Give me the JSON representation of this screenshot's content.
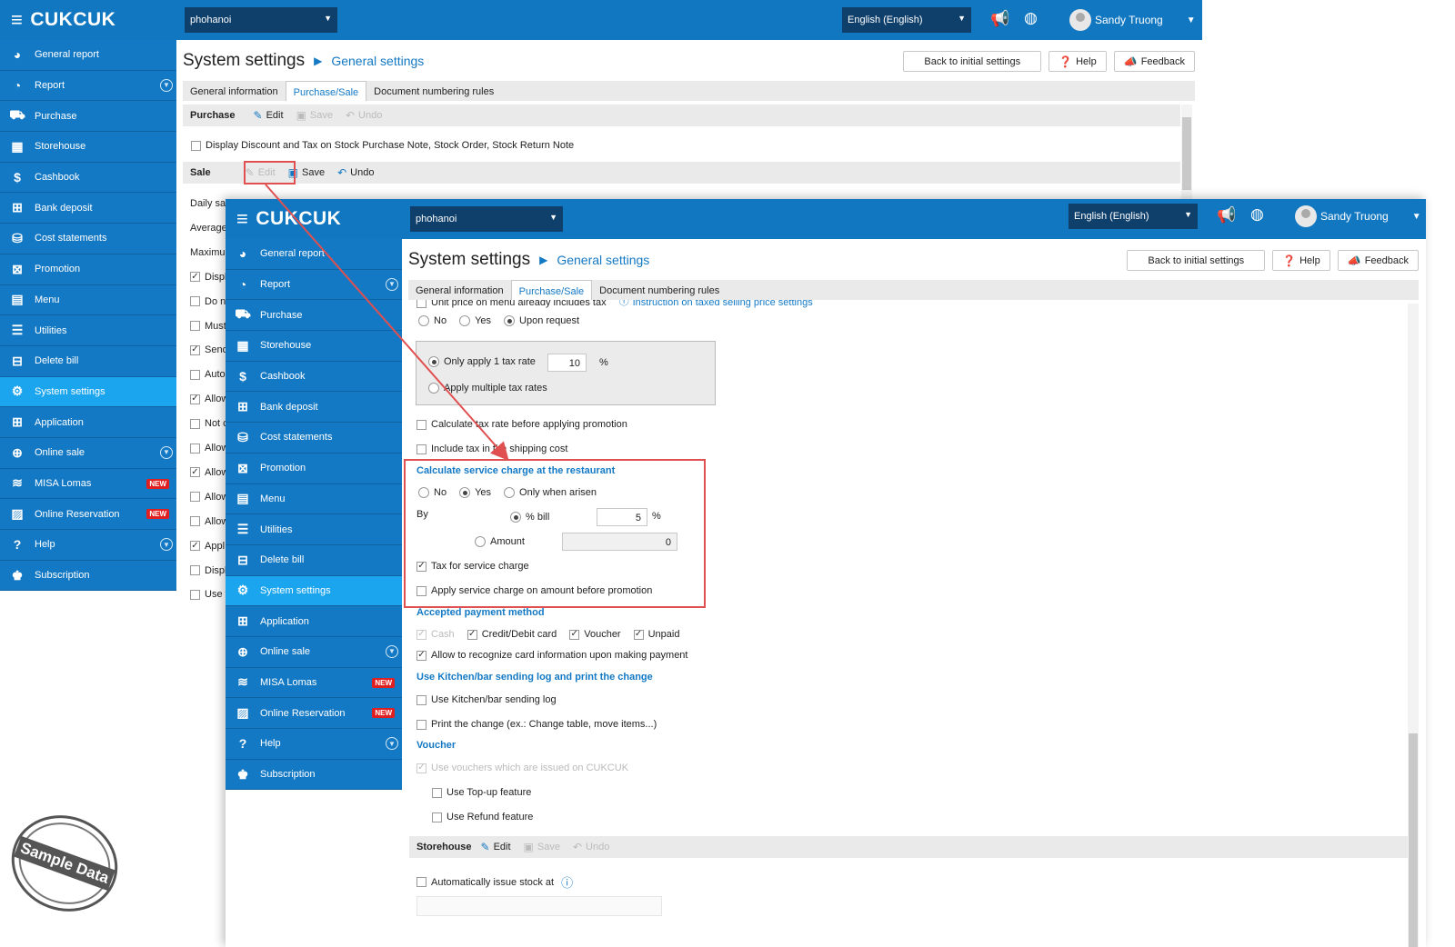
{
  "app": {
    "logo": "CUKCUK",
    "branch": "phohanoi",
    "language": "English (English)",
    "user": "Sandy Truong"
  },
  "sidebar": [
    {
      "label": "General report",
      "icon": "dashboard-icon",
      "glyph": "◕"
    },
    {
      "label": "Report",
      "icon": "pie-chart-icon",
      "glyph": "◔",
      "chevron": true
    },
    {
      "label": "Purchase",
      "icon": "cart-icon",
      "glyph": "⛟"
    },
    {
      "label": "Storehouse",
      "icon": "storehouse-icon",
      "glyph": "▦"
    },
    {
      "label": "Cashbook",
      "icon": "dollar-icon",
      "glyph": "$"
    },
    {
      "label": "Bank deposit",
      "icon": "bank-icon",
      "glyph": "⊞"
    },
    {
      "label": "Cost statements",
      "icon": "cost-icon",
      "glyph": "⛁"
    },
    {
      "label": "Promotion",
      "icon": "gift-icon",
      "glyph": "⊠"
    },
    {
      "label": "Menu",
      "icon": "menu-book-icon",
      "glyph": "▤"
    },
    {
      "label": "Utilities",
      "icon": "list-icon",
      "glyph": "☰"
    },
    {
      "label": "Delete bill",
      "icon": "delete-bill-icon",
      "glyph": "⊟"
    },
    {
      "label": "System settings",
      "icon": "gear-icon",
      "glyph": "⚙",
      "active": true
    },
    {
      "label": "Application",
      "icon": "apps-icon",
      "glyph": "⊞"
    },
    {
      "label": "Online sale",
      "icon": "globe-icon",
      "glyph": "⊕",
      "chevron": true
    },
    {
      "label": "MISA Lomas",
      "icon": "layers-icon",
      "glyph": "≋",
      "badge": "NEW"
    },
    {
      "label": "Online Reservation",
      "icon": "reservation-icon",
      "glyph": "▨",
      "badge": "NEW"
    },
    {
      "label": "Help",
      "icon": "help-icon",
      "glyph": "?",
      "chevron": true
    },
    {
      "label": "Subscription",
      "icon": "users-icon",
      "glyph": "♚"
    }
  ],
  "page": {
    "title": "System settings",
    "subtitle": "General settings",
    "back_label": "Back to initial settings",
    "help_label": "Help",
    "feedback_label": "Feedback"
  },
  "tabs": [
    "General information",
    "Purchase/Sale",
    "Document numbering rules"
  ],
  "actions": {
    "edit": "Edit",
    "save": "Save",
    "undo": "Undo"
  },
  "windowA": {
    "purchase_title": "Purchase",
    "purchase_option": "Display Discount and Tax on Stock Purchase Note, Stock Order, Stock Return Note",
    "sale_title": "Sale",
    "left_fragments": [
      {
        "text": "Daily sa"
      },
      {
        "text": "Average"
      },
      {
        "text": "Maximu"
      },
      {
        "text": "Displ",
        "cb": "✓"
      },
      {
        "text": "Do n",
        "cb": ""
      },
      {
        "text": "Must",
        "cb": ""
      },
      {
        "text": "Send",
        "cb": "✓"
      },
      {
        "text": "Auto",
        "cb": ""
      },
      {
        "text": "Allow",
        "cb": "✓"
      },
      {
        "text": "Not c",
        "cb": ""
      },
      {
        "text": "Allow",
        "cb": ""
      },
      {
        "text": "Allow",
        "cb": "✓"
      },
      {
        "text": "Allow",
        "cb": ""
      },
      {
        "text": "Allow",
        "cb": ""
      },
      {
        "text": "Appl",
        "cb": "✓"
      },
      {
        "text": "Displ",
        "cb": ""
      },
      {
        "text": "Use v",
        "cb": ""
      }
    ]
  },
  "windowB": {
    "cut_line": "Unit price on menu already includes tax",
    "cut_link": "Instruction on taxed selling price settings",
    "tax_opts": {
      "no": "No",
      "yes": "Yes",
      "upon": "Upon request"
    },
    "only_one_rate": "Only apply 1 tax rate",
    "tax_rate": "10",
    "pct": "%",
    "multi_rates": "Apply multiple tax rates",
    "calc_before_promo": "Calculate tax rate before applying promotion",
    "include_tax_ship": "Include tax in the shipping cost",
    "svc_title": "Calculate service charge at the restaurant",
    "svc_opts": {
      "no": "No",
      "yes": "Yes",
      "arisen": "Only when arisen"
    },
    "by_label": "By",
    "pct_bill": "% bill",
    "svc_pct_value": "5",
    "amount_label": "Amount",
    "amount_value": "0",
    "tax_svc": "Tax for service charge",
    "apply_before_promo": "Apply service charge on amount before promotion",
    "payment_title": "Accepted payment method",
    "pay_cash": "Cash",
    "pay_card": "Credit/Debit card",
    "pay_voucher": "Voucher",
    "pay_unpaid": "Unpaid",
    "pay_recognize": "Allow to recognize card information upon making payment",
    "kitchen_title": "Use Kitchen/bar sending log and print the change",
    "kitchen_log": "Use Kitchen/bar sending log",
    "print_change": "Print the change (ex.: Change table, move items...)",
    "voucher_title": "Voucher",
    "voucher_cukcuk": "Use vouchers which are issued on CUKCUK",
    "topup": "Use Top-up feature",
    "refund": "Use Refund feature",
    "storehouse_title": "Storehouse",
    "auto_issue": "Automatically issue stock at"
  },
  "stamp": "Sample Data",
  "colors": {
    "brand": "#1177c1",
    "sidebar": "#1479c4",
    "active": "#1aa5ee",
    "highlight": "#e05050"
  }
}
